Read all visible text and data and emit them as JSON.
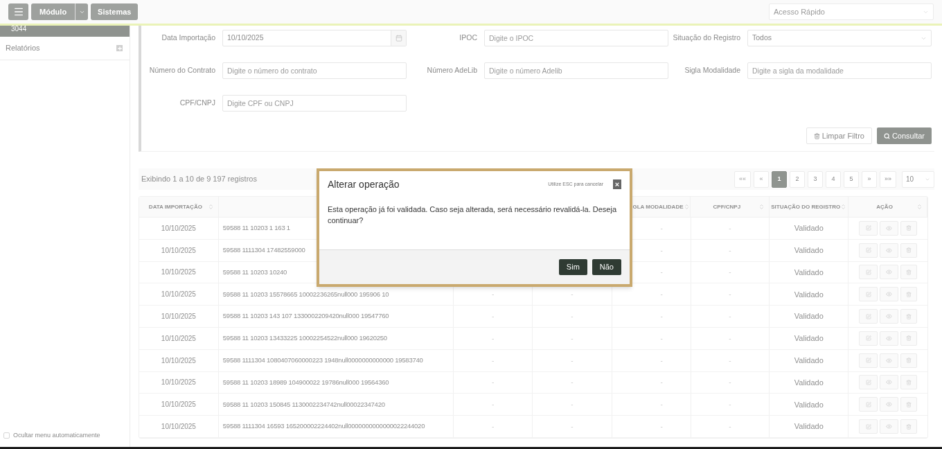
{
  "topbar": {
    "module_button": "Módulo",
    "systems_button": "Sistemas",
    "quick_access": {
      "placeholder": "Acesso Rápido"
    }
  },
  "sidebar": {
    "header": "3044",
    "items": [
      {
        "label": "Relatórios",
        "expanded": false
      }
    ],
    "auto_hide": {
      "label": "Ocultar menu automaticamente",
      "checked": false
    }
  },
  "filters": {
    "fields": [
      {
        "label": "Data Importação",
        "kind": "date",
        "value": "10/10/2025"
      },
      {
        "label": "IPOC",
        "kind": "text",
        "placeholder": "Digite o IPOC"
      },
      {
        "label": "Situação do Registro",
        "kind": "select",
        "value": "Todos"
      },
      {
        "label": "Número do Contrato",
        "kind": "text",
        "placeholder": "Digite o número do contrato"
      },
      {
        "label": "Número AdeLib",
        "kind": "text",
        "placeholder": "Digite o número Adelib"
      },
      {
        "label": "Sigla Modalidade",
        "kind": "text",
        "placeholder": "Digite a sigla da modalidade"
      },
      {
        "label": "CPF/CNPJ",
        "kind": "text",
        "placeholder": "Digite CPF ou CNPJ"
      }
    ],
    "clear_button": "Limpar Filtro",
    "search_button": "Consultar"
  },
  "results": {
    "summary": "Exibindo 1 a 10 de 9 197 registros",
    "pagination": [
      {
        "label": "««",
        "selected": false,
        "disabled": true
      },
      {
        "label": "«",
        "selected": false,
        "disabled": true
      },
      {
        "label": "1",
        "selected": true,
        "disabled": false
      },
      {
        "label": "2",
        "selected": false,
        "disabled": false
      },
      {
        "label": "3",
        "selected": false,
        "disabled": false
      },
      {
        "label": "4",
        "selected": false,
        "disabled": false
      },
      {
        "label": "5",
        "selected": false,
        "disabled": false
      },
      {
        "label": "»",
        "selected": false,
        "disabled": false
      },
      {
        "label": "»»",
        "selected": false,
        "disabled": false
      }
    ],
    "page_size": "10"
  },
  "table": {
    "columns": [
      {
        "label": "DATA IMPORTAÇÃO"
      },
      {
        "label": "GLA MODALIDADE"
      },
      {
        "label": "CPF/CNPJ"
      },
      {
        "label": "SITUAÇÃO DO REGISTRO"
      },
      {
        "label": "AÇÃO"
      }
    ],
    "rows": [
      {
        "date": "10/10/2025",
        "code": "59588 11 10203 1 163 1",
        "sigla": "-",
        "cpf": "-",
        "status": "Validado"
      },
      {
        "date": "10/10/2025",
        "code": "59588 1111304 17482559000",
        "sigla": "-",
        "cpf": "-",
        "status": "Validado"
      },
      {
        "date": "10/10/2025",
        "code": "59588 11 10203 10240",
        "sigla": "-",
        "cpf": "-",
        "status": "Validado"
      },
      {
        "date": "10/10/2025",
        "code": "59588 11 10203 15578665 10002236265null000 195906 10",
        "column_3": "-",
        "column_4": "-",
        "sigla": "-",
        "cpf": "-",
        "status": "Validado"
      },
      {
        "date": "10/10/2025",
        "code": "59588 11 10203 143 107 1330002209420null000 19547760",
        "column_3": "-",
        "column_4": "-",
        "sigla": "-",
        "cpf": "-",
        "status": "Validado"
      },
      {
        "date": "10/10/2025",
        "code": "59588 11 10203 13433225 10002254522null000 19620250",
        "column_3": "-",
        "column_4": "-",
        "sigla": "-",
        "cpf": "-",
        "status": "Validado"
      },
      {
        "date": "10/10/2025",
        "code": "59588 1111304 1080407060000223 1948null0000000000000 19583740",
        "column_3": "-",
        "column_4": "-",
        "sigla": "-",
        "cpf": "-",
        "status": "Validado"
      },
      {
        "date": "10/10/2025",
        "code": "59588 11 10203 18989 104900022 19786null000 19564360",
        "column_3": "-",
        "column_4": "-",
        "sigla": "-",
        "cpf": "-",
        "status": "Validado"
      },
      {
        "date": "10/10/2025",
        "code": "59588 11 10203 150845 1130002234742null00022347420",
        "column_3": "-",
        "column_4": "-",
        "sigla": "-",
        "cpf": "-",
        "status": "Validado"
      },
      {
        "date": "10/10/2025",
        "code": "59588 1111304 16593 165200002224402null0000000000000022244020",
        "column_3": "-",
        "column_4": "-",
        "sigla": "-",
        "cpf": "-",
        "status": "Validado"
      }
    ]
  },
  "dialog": {
    "title": "Alterar operação",
    "hint": "Utilize ESC para cancelar",
    "close": "×",
    "message": "Esta operação já foi validada. Caso seja alterada, será necessário revalidá-la. Deseja continuar?",
    "buttons": [
      "Sim",
      "Não"
    ]
  }
}
